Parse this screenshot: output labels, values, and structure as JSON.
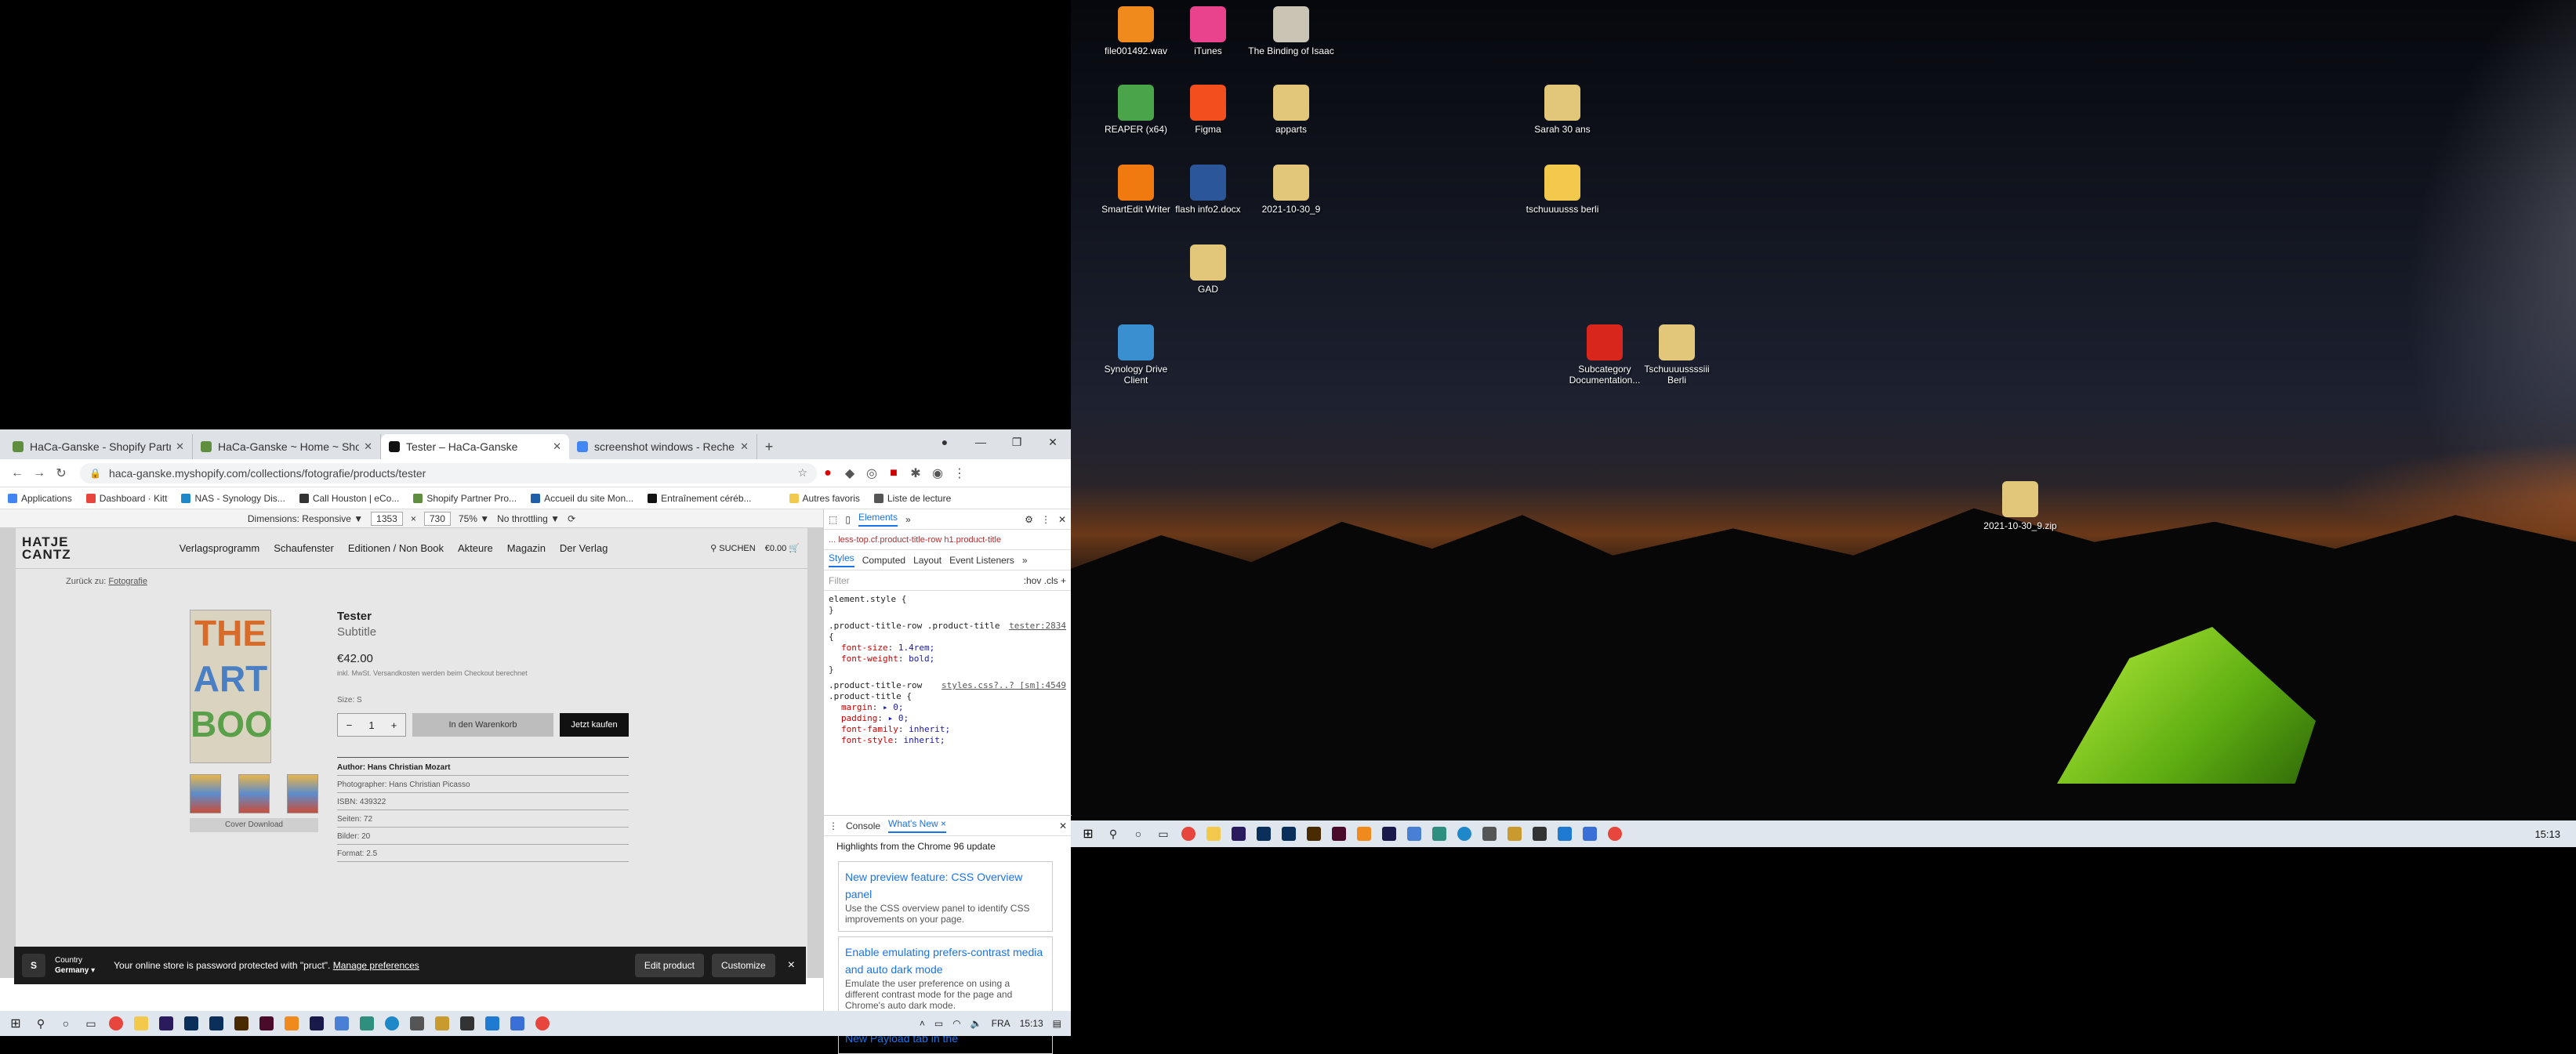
{
  "desktop": {
    "icons": [
      {
        "label": "file001492.wav",
        "glyph": "cone-icon",
        "color": "#f08a1c"
      },
      {
        "label": "iTunes",
        "glyph": "music-icon",
        "color": "#e9438e"
      },
      {
        "label": "The Binding of Isaac",
        "glyph": "game-icon",
        "color": "#c9c4b4"
      },
      {
        "label": "REAPER (x64)",
        "glyph": "reaper-icon",
        "color": "#4aa54a"
      },
      {
        "label": "Figma",
        "glyph": "figma-icon",
        "color": "#f24e1e"
      },
      {
        "label": "apparts",
        "glyph": "zip-folder-icon",
        "color": "#e2c77a"
      },
      {
        "label": "Sarah 30 ans",
        "glyph": "zip-folder-icon",
        "color": "#e2c77a"
      },
      {
        "label": "SmartEdit Writer",
        "glyph": "writer-icon",
        "color": "#f07a10"
      },
      {
        "label": "flash info2.docx",
        "glyph": "word-icon",
        "color": "#2b579a"
      },
      {
        "label": "2021-10-30_9",
        "glyph": "zip-folder-icon",
        "color": "#e2c77a"
      },
      {
        "label": "tschuuuusss berli",
        "glyph": "folder-icon",
        "color": "#f2c94c"
      },
      {
        "label": "GAD",
        "glyph": "zip-folder-icon",
        "color": "#e2c77a"
      },
      {
        "label": "Synology Drive Client",
        "glyph": "synology-icon",
        "color": "#3a8fd1"
      },
      {
        "label": "Subcategory Documentation...",
        "glyph": "pdf-icon",
        "color": "#d9261c"
      },
      {
        "label": "Tschuuuussssiii Berli",
        "glyph": "zip-folder-icon",
        "color": "#e2c77a"
      },
      {
        "label": "2021-10-30_9.zip",
        "glyph": "zip-folder-icon",
        "color": "#e2c77a"
      }
    ],
    "clock": "15:13"
  },
  "browser": {
    "tabs": [
      {
        "title": "HaCa-Ganske - Shopify Partners",
        "color": "#5e8e3e"
      },
      {
        "title": "HaCa-Ganske ~ Home ~ Shopify",
        "color": "#5e8e3e"
      },
      {
        "title": "Tester – HaCa-Ganske",
        "color": "#111111"
      },
      {
        "title": "screenshot windows - Recherche",
        "color": "#4285f4"
      }
    ],
    "new_tab": "+",
    "url": "haca-ganske.myshopify.com/collections/fotografie/products/tester",
    "bookmarks": [
      "Applications",
      "Dashboard · Kitt",
      "NAS - Synology Dis...",
      "Call Houston | eCo...",
      "Shopify Partner Pro...",
      "Accueil du site Mon...",
      "Entraînement céréb...",
      "Autres favoris",
      "Liste de lecture"
    ],
    "device_toolbar": {
      "dimensions": "Dimensions: Responsive ▼",
      "width": "1353",
      "times": "×",
      "height": "730",
      "zoom": "75% ▼",
      "throttle": "No throttling ▼"
    }
  },
  "shop": {
    "logo_line1": "HATJE",
    "logo_line2": "CANTZ",
    "nav": [
      "Verlagsprogramm",
      "Schaufenster",
      "Editionen / Non Book",
      "Akteure",
      "Magazin",
      "Der Verlag"
    ],
    "search": "SUCHEN",
    "cart": "€0.00",
    "back_prefix": "Zurück zu:",
    "back_link": "Fotografie",
    "cover_lines": [
      "THE",
      "ART",
      "BOOK"
    ],
    "cover_download": "Cover Download",
    "title": "Tester",
    "subtitle": "Subtitle",
    "price": "€42.00",
    "tax_note": "inkl. MwSt. Versandkosten werden beim Checkout berechnet",
    "size_label": "Size: S",
    "qty_minus": "−",
    "qty_value": "1",
    "qty_plus": "+",
    "add_to_cart": "In den Warenkorb",
    "buy_now": "Jetzt kaufen",
    "meta": [
      "Author: Hans Christian Mozart",
      "Photographer: Hans Christian Picasso",
      "ISBN: 439322",
      "Seiten: 72",
      "Bilder: 20",
      "Format: 2.5"
    ],
    "admin_bar": {
      "country_label": "Country",
      "country": "Germany ▾",
      "message": "Your online store is password protected with \"pruct\".",
      "manage": "Manage preferences",
      "edit": "Edit product",
      "customize": "Customize",
      "close": "×"
    }
  },
  "devtools": {
    "tabs": [
      "Elements",
      "»"
    ],
    "breadcrumb": "... less-top.cf.product-title-row  h1.product-title",
    "pane_tabs": [
      "Styles",
      "Computed",
      "Layout",
      "Event Listeners",
      "»"
    ],
    "filter": "Filter",
    "hov": ":hov  .cls  +",
    "rules": [
      {
        "selector": "element.style {",
        "source": "",
        "decls": [],
        "close": "}"
      },
      {
        "selector": ".product-title-row .product-title {",
        "source": "tester:2834",
        "decls": [
          [
            "font-size",
            "1.4rem;"
          ],
          [
            "font-weight",
            "bold;"
          ]
        ],
        "close": "}"
      },
      {
        "selector": ".product-title-row .product-title {",
        "source": "styles.css?..? [sm]:4549",
        "decls": [
          [
            "margin",
            "▸ 0;"
          ],
          [
            "padding",
            "▸ 0;"
          ],
          [
            "font-family",
            "inherit;"
          ],
          [
            "font-style",
            "inherit;"
          ]
        ],
        "close": ""
      }
    ],
    "drawer_tabs": [
      "Console",
      "What's New ×"
    ],
    "highlights": "Highlights from the Chrome 96 update",
    "cards": [
      {
        "title": "New preview feature: CSS Overview panel",
        "text": "Use the CSS overview panel to identify CSS improvements on your page."
      },
      {
        "title": "Enable emulating prefers-contrast media and auto dark mode",
        "text": "Emulate the user preference on using a different contrast mode for the page and Chrome's auto dark mode."
      },
      {
        "title": "New Payload tab in the",
        "text": ""
      }
    ]
  },
  "left_taskbar": {
    "lang": "FRA",
    "clock": "15:13"
  }
}
